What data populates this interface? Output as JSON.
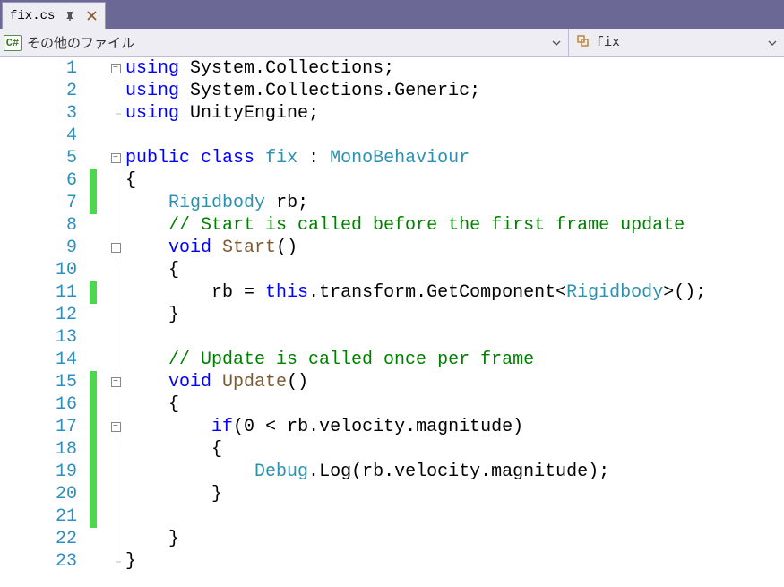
{
  "tab": {
    "filename": "fix.cs"
  },
  "navbar": {
    "left_label": "その他のファイル",
    "right_label": "fix",
    "cs_icon_text": "C#"
  },
  "code": {
    "lines": [
      {
        "n": 1,
        "indent": 0,
        "fold": "minus",
        "mod": false,
        "tokens": [
          [
            "kw",
            "using"
          ],
          [
            "punct",
            " "
          ],
          [
            "ident",
            "System"
          ],
          [
            "punct",
            "."
          ],
          [
            "ident",
            "Collections"
          ],
          [
            "punct",
            ";"
          ]
        ]
      },
      {
        "n": 2,
        "indent": 0,
        "fold": "pipe",
        "mod": false,
        "tokens": [
          [
            "kw",
            "using"
          ],
          [
            "punct",
            " "
          ],
          [
            "ident",
            "System"
          ],
          [
            "punct",
            "."
          ],
          [
            "ident",
            "Collections"
          ],
          [
            "punct",
            "."
          ],
          [
            "ident",
            "Generic"
          ],
          [
            "punct",
            ";"
          ]
        ]
      },
      {
        "n": 3,
        "indent": 0,
        "fold": "end",
        "mod": false,
        "tokens": [
          [
            "kw",
            "using"
          ],
          [
            "punct",
            " "
          ],
          [
            "ident",
            "UnityEngine"
          ],
          [
            "punct",
            ";"
          ]
        ]
      },
      {
        "n": 4,
        "indent": 0,
        "fold": "",
        "mod": false,
        "tokens": []
      },
      {
        "n": 5,
        "indent": 0,
        "fold": "minus",
        "mod": false,
        "tokens": [
          [
            "kw",
            "public"
          ],
          [
            "punct",
            " "
          ],
          [
            "kw",
            "class"
          ],
          [
            "punct",
            " "
          ],
          [
            "cls",
            "fix"
          ],
          [
            "punct",
            " : "
          ],
          [
            "type",
            "MonoBehaviour"
          ]
        ]
      },
      {
        "n": 6,
        "indent": 0,
        "fold": "pipe",
        "mod": true,
        "tokens": [
          [
            "punct",
            "{"
          ]
        ]
      },
      {
        "n": 7,
        "indent": 1,
        "fold": "pipe",
        "mod": true,
        "tokens": [
          [
            "type",
            "Rigidbody"
          ],
          [
            "punct",
            " "
          ],
          [
            "ident",
            "rb"
          ],
          [
            "punct",
            ";"
          ]
        ]
      },
      {
        "n": 8,
        "indent": 1,
        "fold": "pipe",
        "mod": false,
        "tokens": [
          [
            "comment",
            "// Start is called before the first frame update"
          ]
        ]
      },
      {
        "n": 9,
        "indent": 1,
        "fold": "minus",
        "mod": false,
        "tokens": [
          [
            "kw",
            "void"
          ],
          [
            "punct",
            " "
          ],
          [
            "method",
            "Start"
          ],
          [
            "punct",
            "()"
          ]
        ]
      },
      {
        "n": 10,
        "indent": 1,
        "fold": "pipe",
        "mod": false,
        "tokens": [
          [
            "punct",
            "{"
          ]
        ]
      },
      {
        "n": 11,
        "indent": 2,
        "fold": "pipe",
        "mod": true,
        "tokens": [
          [
            "ident",
            "rb"
          ],
          [
            "punct",
            " = "
          ],
          [
            "kw",
            "this"
          ],
          [
            "punct",
            "."
          ],
          [
            "ident",
            "transform"
          ],
          [
            "punct",
            "."
          ],
          [
            "ident",
            "GetComponent"
          ],
          [
            "punct",
            "<"
          ],
          [
            "type",
            "Rigidbody"
          ],
          [
            "punct",
            ">();"
          ]
        ]
      },
      {
        "n": 12,
        "indent": 1,
        "fold": "pipe",
        "mod": false,
        "tokens": [
          [
            "punct",
            "}"
          ]
        ]
      },
      {
        "n": 13,
        "indent": 0,
        "fold": "pipe",
        "mod": false,
        "tokens": []
      },
      {
        "n": 14,
        "indent": 1,
        "fold": "pipe",
        "mod": false,
        "tokens": [
          [
            "comment",
            "// Update is called once per frame"
          ]
        ]
      },
      {
        "n": 15,
        "indent": 1,
        "fold": "minus",
        "mod": true,
        "tokens": [
          [
            "kw",
            "void"
          ],
          [
            "punct",
            " "
          ],
          [
            "method",
            "Update"
          ],
          [
            "punct",
            "()"
          ]
        ]
      },
      {
        "n": 16,
        "indent": 1,
        "fold": "pipe",
        "mod": true,
        "tokens": [
          [
            "punct",
            "{"
          ]
        ]
      },
      {
        "n": 17,
        "indent": 2,
        "fold": "minus",
        "mod": true,
        "tokens": [
          [
            "kw",
            "if"
          ],
          [
            "punct",
            "("
          ],
          [
            "num",
            "0"
          ],
          [
            "punct",
            " < "
          ],
          [
            "ident",
            "rb"
          ],
          [
            "punct",
            "."
          ],
          [
            "ident",
            "velocity"
          ],
          [
            "punct",
            "."
          ],
          [
            "ident",
            "magnitude"
          ],
          [
            "punct",
            ")"
          ]
        ]
      },
      {
        "n": 18,
        "indent": 2,
        "fold": "pipe",
        "mod": true,
        "tokens": [
          [
            "punct",
            "{"
          ]
        ]
      },
      {
        "n": 19,
        "indent": 3,
        "fold": "pipe",
        "mod": true,
        "tokens": [
          [
            "type",
            "Debug"
          ],
          [
            "punct",
            "."
          ],
          [
            "ident",
            "Log"
          ],
          [
            "punct",
            "("
          ],
          [
            "ident",
            "rb"
          ],
          [
            "punct",
            "."
          ],
          [
            "ident",
            "velocity"
          ],
          [
            "punct",
            "."
          ],
          [
            "ident",
            "magnitude"
          ],
          [
            "punct",
            ");"
          ]
        ]
      },
      {
        "n": 20,
        "indent": 2,
        "fold": "pipe",
        "mod": true,
        "tokens": [
          [
            "punct",
            "}"
          ]
        ]
      },
      {
        "n": 21,
        "indent": 0,
        "fold": "pipe",
        "mod": true,
        "tokens": []
      },
      {
        "n": 22,
        "indent": 1,
        "fold": "pipe",
        "mod": false,
        "tokens": [
          [
            "punct",
            "}"
          ]
        ]
      },
      {
        "n": 23,
        "indent": 0,
        "fold": "end",
        "mod": false,
        "tokens": [
          [
            "punct",
            "}"
          ]
        ]
      }
    ]
  }
}
